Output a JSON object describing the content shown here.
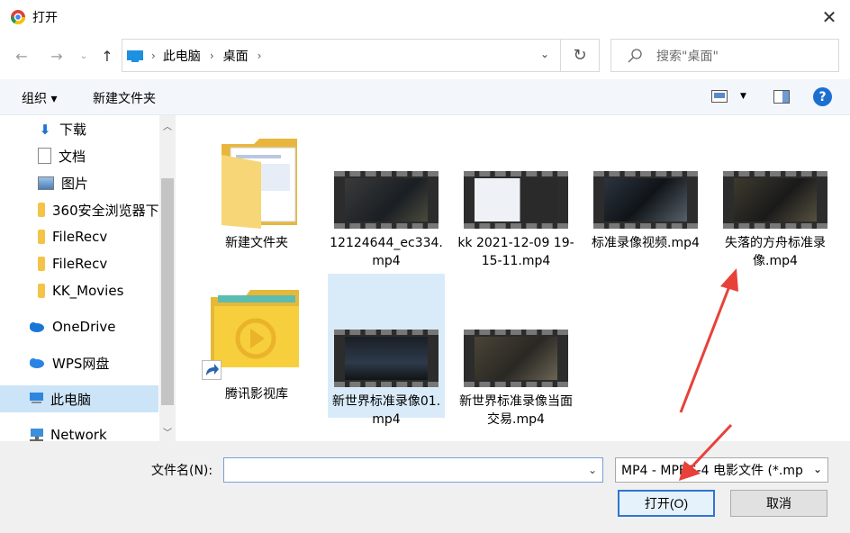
{
  "window": {
    "title": "打开"
  },
  "nav": {
    "breadcrumb": [
      "此电脑",
      "桌面"
    ],
    "search_placeholder": "搜索\"桌面\""
  },
  "toolbar": {
    "organize": "组织 ▾",
    "new_folder": "新建文件夹"
  },
  "sidebar": {
    "items": [
      {
        "label": "下载",
        "pinned": true
      },
      {
        "label": "文档",
        "pinned": true
      },
      {
        "label": "图片",
        "pinned": true
      },
      {
        "label": "360安全浏览器下"
      },
      {
        "label": "FileRecv"
      },
      {
        "label": "FileRecv"
      },
      {
        "label": "KK_Movies"
      },
      {
        "label": "OneDrive"
      },
      {
        "label": "WPS网盘"
      },
      {
        "label": "此电脑",
        "selected": true
      },
      {
        "label": "Network"
      }
    ]
  },
  "files": [
    {
      "name": "新建文件夹",
      "type": "folder"
    },
    {
      "name": "12124644_ec334.mp4",
      "type": "video"
    },
    {
      "name": "kk 2021-12-09 19-15-11.mp4",
      "type": "video"
    },
    {
      "name": "标准录像视频.mp4",
      "type": "video"
    },
    {
      "name": "失落的方舟标准录像.mp4",
      "type": "video"
    },
    {
      "name": "腾讯影视库",
      "type": "shortcut"
    },
    {
      "name": "新世界标准录像01.mp4",
      "type": "video",
      "selected": true
    },
    {
      "name": "新世界标准录像当面交易.mp4",
      "type": "video"
    }
  ],
  "bottom": {
    "filename_label": "文件名(N):",
    "filename_value": "",
    "filter_value": "MP4 - MPEG-4 电影文件 (*.mp",
    "open_label": "打开(O)",
    "cancel_label": "取消"
  },
  "colors": {
    "accent": "#2f75d1",
    "selection": "#d9ebf9",
    "annotation_arrow": "#e8413a"
  }
}
